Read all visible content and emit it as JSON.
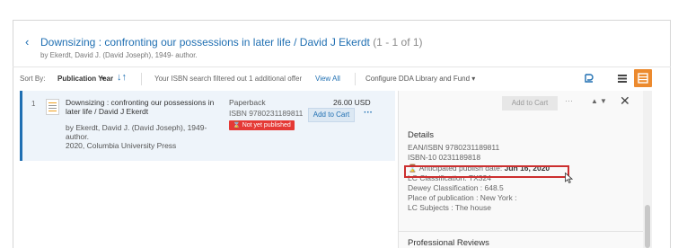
{
  "header": {
    "back_glyph": "‹",
    "title": "Downsizing : confronting our possessions in later life / David J Ekerdt",
    "count": "(1 - 1 of 1)",
    "subtitle": "by Ekerdt, David J. (David Joseph), 1949- author."
  },
  "toolbar": {
    "sort_label": "Sort By:",
    "sort_value": "Publication Year",
    "sort_caret": "▾",
    "sort_dir_glyph": "↓↑",
    "isbn_note": "Your ISBN search filtered out 1 additional offer",
    "view_all": "View All",
    "configure": "Configure DDA Library and Fund ▾"
  },
  "result": {
    "number": "1",
    "title": "Downsizing : confronting our possessions in later life / David J Ekerdt",
    "author": "by Ekerdt, David J. (David Joseph), 1949- author.",
    "publication": "2020, Columbia University Press",
    "format": "Paperback",
    "isbn": "ISBN 9780231189811",
    "badge": "Not yet published",
    "price": "26.00 USD",
    "add_to_cart": "Add to Cart",
    "more": "···"
  },
  "panel": {
    "add_to_cart": "Add to Cart",
    "more": "···",
    "up": "▲",
    "down": "▼",
    "close": "✕",
    "details_heading": "Details",
    "ean": "EAN/ISBN 9780231189811",
    "isbn10": "ISBN-10 0231189818",
    "anticipated_label": "Anticipated publish date:",
    "anticipated_date": "Jun 16, 2020",
    "lc_class": "LC Classification: TX324",
    "dewey": "Dewey Classification : 648.5",
    "place": "Place of publication : New York :",
    "subjects": "LC Subjects : The house",
    "reviews_heading": "Professional Reviews"
  },
  "colors": {
    "accent": "#1f6fb2",
    "badge_red": "#e53935",
    "highlight_red": "#cc2f2f",
    "grid_view_orange": "#ec8a2e",
    "row_bg": "#eef4fa"
  },
  "icons": {
    "sort_direction": "sort-direction-icon",
    "export": "export-icon",
    "list_view": "list-view-icon",
    "grid_view": "grid-view-icon",
    "hourglass": "hourglass-icon",
    "book_thumbnail": "book-cover-thumbnail"
  }
}
